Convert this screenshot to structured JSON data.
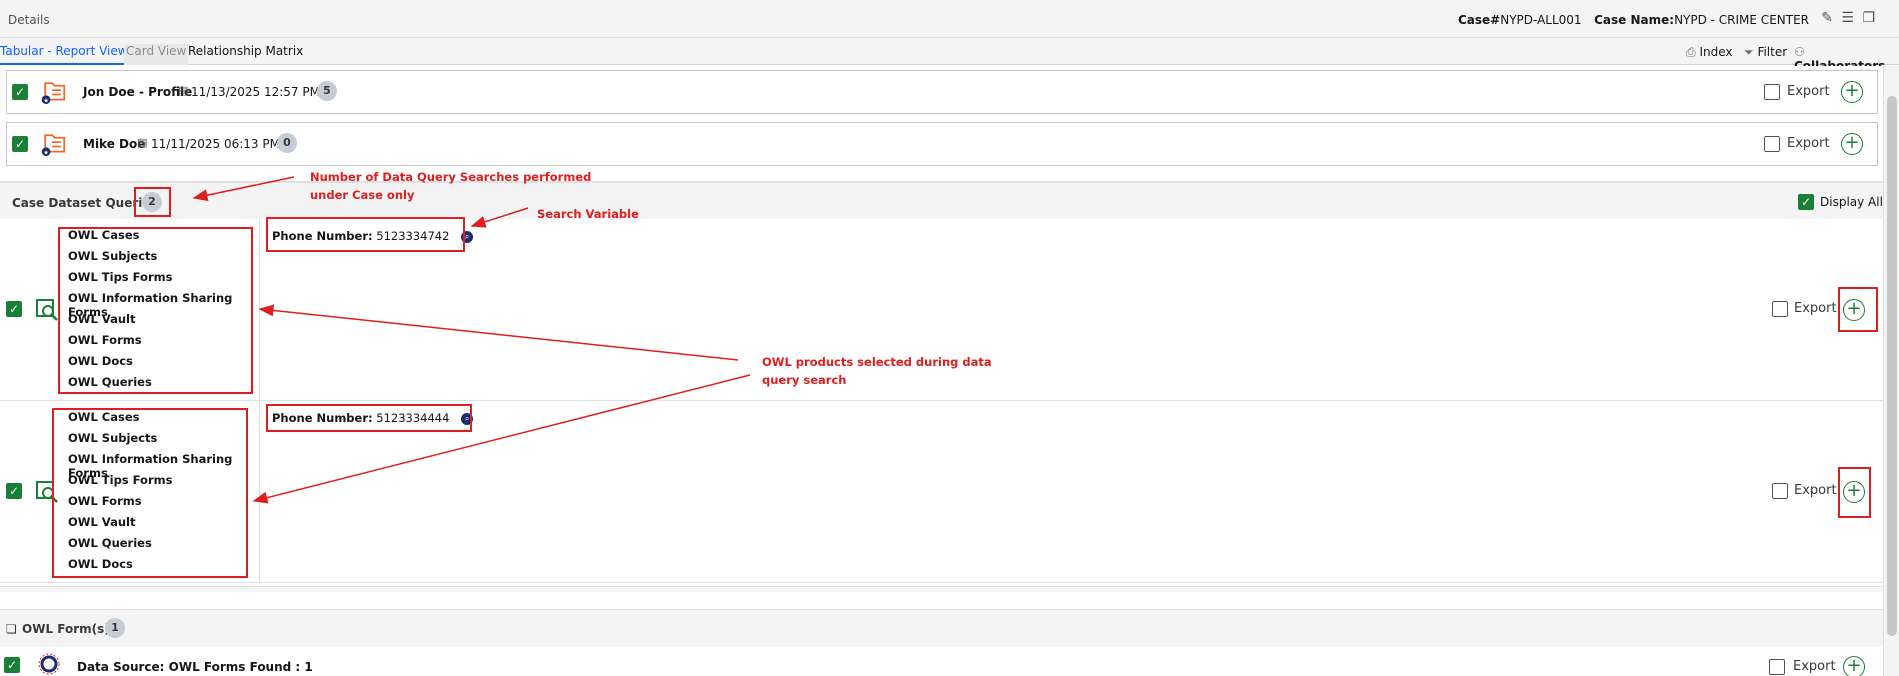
{
  "header": {
    "title": "Details",
    "case_number_label": "Case#",
    "case_number": "NYPD-ALL001",
    "case_name_label": "Case Name:",
    "case_name": "NYPD - CRIME CENTER"
  },
  "tabs": [
    {
      "label": "Tabular - Report View"
    },
    {
      "label": "Card View"
    },
    {
      "label": "Relationship Matrix"
    }
  ],
  "tools": {
    "index": "Index",
    "filter": "Filter",
    "collaborators": "Collaborators"
  },
  "profiles": [
    {
      "name": "Jon Doe - Profile",
      "date": "11/13/2025 12:57 PM",
      "count": "5",
      "export": "Export"
    },
    {
      "name": "Mike Doe",
      "date": "11/11/2025 06:13 PM",
      "count": "0",
      "export": "Export"
    }
  ],
  "queries_section": {
    "title": "Case Dataset Queries",
    "count": "2",
    "display_all": "Display All"
  },
  "queries": [
    {
      "products": [
        "OWL Cases",
        "OWL Subjects",
        "OWL Tips Forms",
        "OWL Information Sharing Forms",
        "OWL Vault",
        "OWL Forms",
        "OWL Docs",
        "OWL Queries"
      ],
      "variable_label": "Phone Number:",
      "variable_value": "5123334742",
      "export": "Export"
    },
    {
      "products": [
        "OWL Cases",
        "OWL Subjects",
        "OWL Information Sharing Forms",
        "OWL Tips Forms",
        "OWL Forms",
        "OWL Vault",
        "OWL Queries",
        "OWL Docs"
      ],
      "variable_label": "Phone Number:",
      "variable_value": "5123334444",
      "export": "Export"
    }
  ],
  "forms_section": {
    "title": "OWL Form(s)",
    "count": "1",
    "row_label": "Data Source: OWL Forms Found : 1",
    "export": "Export"
  },
  "annotations": {
    "searches_count": [
      "Number of Data Query Searches performed",
      "under Case only"
    ],
    "search_variable": "Search Variable",
    "products_selected": [
      "OWL products selected during data",
      "query search"
    ]
  },
  "colors": {
    "accent": "#0f62fe",
    "check_green": "#198038",
    "annotation_red": "#e01e1e",
    "folder_orange": "#f26522"
  }
}
